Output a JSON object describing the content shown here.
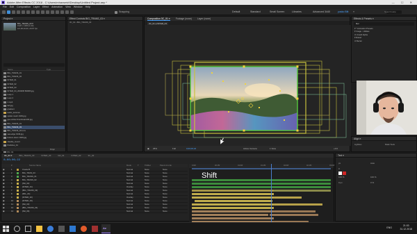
{
  "window": {
    "title": "Adobe After Effects CC 2018 - C:\\Users\\mhaxsmid\\Desktop\\Untitled Project.aep *",
    "controls": [
      "—",
      "☐",
      "✕"
    ]
  },
  "menu": [
    "File",
    "Edit",
    "Composition",
    "Layer",
    "Effect",
    "Animation",
    "View",
    "Window",
    "Help"
  ],
  "toolbar": {
    "snapping_label": "Snapping",
    "workspaces": [
      "Default",
      "Standard",
      "Small Screen",
      "Libraries",
      "Advanced 3440",
      "yusko Blit",
      "»"
    ],
    "active_workspace": "yusko Blit",
    "search_placeholder": "Search Help"
  },
  "project": {
    "title": "Project ≡",
    "selected_name": "BIG_TRANS_03 ▾",
    "info_lines": [
      "1920 x 1080 (1.00)",
      "Δ 0;00;10;00, 29.97 fps"
    ],
    "columns": [
      "Name",
      "Type"
    ],
    "items": [
      {
        "name": "BIG_TRANS_01",
        "folder": false,
        "selected": false
      },
      {
        "name": "BIG_TRANS_02",
        "folder": false,
        "selected": false
      },
      {
        "name": "INTER_01",
        "folder": false,
        "selected": false
      },
      {
        "name": "INTER_02",
        "folder": false,
        "selected": false
      },
      {
        "name": "INTER_03",
        "folder": false,
        "selected": false
      },
      {
        "name": "INTER_04_2000KB 800KB.jpg",
        "folder": false,
        "selected": false
      },
      {
        "name": "Loop 1",
        "folder": false,
        "selected": false
      },
      {
        "name": "Loop 2",
        "folder": false,
        "selected": false
      },
      {
        "name": "1.mp4",
        "folder": false,
        "selected": false
      },
      {
        "name": "bkf.jpg",
        "folder": false,
        "selected": false
      },
      {
        "name": "gradient",
        "folder": false,
        "selected": false
      },
      {
        "name": "audio_textures",
        "folder": true,
        "selected": false
      },
      {
        "name": "  spider-mesh 1949.jpg",
        "folder": false,
        "selected": false
      },
      {
        "name": "  gee-winter-thumbnail-200.jpg",
        "folder": false,
        "selected": false
      },
      {
        "name": "  BIG_TRANS_01",
        "folder": false,
        "selected": false
      },
      {
        "name": "  BIG_TRANS_03",
        "folder": false,
        "selected": true
      },
      {
        "name": "  BIG_TRANS_04.mov",
        "folder": false,
        "selected": false
      },
      {
        "name": "  sea-edge 1949.jpg",
        "folder": false,
        "selected": false
      },
      {
        "name": "  bottom-down 1949.jpg",
        "folder": false,
        "selected": false
      },
      {
        "name": "claudia_mount",
        "folder": true,
        "selected": false
      },
      {
        "name": "Particles_01",
        "folder": false,
        "selected": false
      },
      {
        "name": "Particles_02 copy",
        "folder": false,
        "selected": false
      },
      {
        "name": "Pin_01",
        "folder": false,
        "selected": false
      },
      {
        "name": "F_01",
        "folder": false,
        "selected": false
      },
      {
        "name": "solids",
        "folder": true,
        "selected": false
      },
      {
        "name": "black",
        "folder": false,
        "selected": false
      }
    ],
    "footer": "8 bpc"
  },
  "effect_controls": {
    "title": "Effect Controls BIG_TRANS_03 ≡",
    "breadcrumb": "3C_01 • BIG_TRANS_03"
  },
  "viewer": {
    "tabs": [
      "Composition 3C_01 ≡",
      "Footage (none)",
      "Layer (none)"
    ],
    "active_tab": "Composition 3C_01 ≡",
    "breadcrumb": "3C_01 ◂ INTER_03",
    "zoom": "25%",
    "resolution": "Full",
    "camera": "Active Camera",
    "views": "1 View",
    "timecode": "0;00;06;22",
    "exposure": "+0.0"
  },
  "effects_presets": {
    "title": "Effects & Presets ≡",
    "search_value": "blur",
    "lines": [
      "▾ * Animation Presets",
      "   ▾ Image - Utilities",
      "        ⦾ Unsoft Alpha",
      "▾ Distort",
      "        ⦾ Bezier"
    ]
  },
  "align": {
    "title": "Align ≡",
    "lights_label": "Lightbox",
    "layers_label": "Mask Tools"
  },
  "timeline": {
    "tabs": [
      "3C_01 ≡",
      "BIG_TRANS_03",
      "INTER_03",
      "bkf_01",
      "INTER_02",
      "3C_02"
    ],
    "active_tab": "3C_01 ≡",
    "current_time": "0;00;06;22",
    "header": [
      "#",
      "Source Name",
      "Mode",
      "T",
      "TrkMat",
      "Parent & Link"
    ],
    "layers": [
      {
        "num": "1",
        "name": "Create B",
        "mode": "Normal",
        "trkmat": "None",
        "parent": "None",
        "color": "#c0a040"
      },
      {
        "num": "2",
        "name": "BIG_TRAN_03",
        "mode": "Normal",
        "trkmat": "None",
        "parent": "None",
        "color": "#4fa84f"
      },
      {
        "num": "3",
        "name": "BIG_TRANS_01",
        "mode": "Normal",
        "trkmat": "None",
        "parent": "None",
        "color": "#4fa84f"
      },
      {
        "num": "4",
        "name": "BIG_TRANS_02",
        "mode": "Normal",
        "trkmat": "None",
        "parent": "None",
        "color": "#c9b04c"
      },
      {
        "num": "5",
        "name": "[Pal_02]",
        "mode": "Normal",
        "trkmat": "None",
        "parent": "None",
        "color": "#c9b04c"
      },
      {
        "num": "6",
        "name": "[INTER_01]",
        "mode": "Overlay",
        "trkmat": "None",
        "parent": "None",
        "color": "#c9b04c"
      },
      {
        "num": "7",
        "name": "[BIG_TRANS_03]",
        "mode": "Normal",
        "trkmat": "None",
        "parent": "None",
        "color": "#c9b04c"
      },
      {
        "num": "8",
        "name": "[PAL_01]",
        "mode": "Normal",
        "trkmat": "None",
        "parent": "None",
        "color": "#c9b04c"
      },
      {
        "num": "9",
        "name": "[INTER_02]",
        "mode": "Overlay",
        "trkmat": "None",
        "parent": "None",
        "color": "#c9b04c"
      },
      {
        "num": "10",
        "name": "[INTER_03]",
        "mode": "Normal",
        "trkmat": "None",
        "parent": "None",
        "color": "#b38b59"
      },
      {
        "num": "11",
        "name": "[Pal_03]",
        "mode": "Normal",
        "trkmat": "None",
        "parent": "None",
        "color": "#b38b59"
      },
      {
        "num": "12",
        "name": "[BIG_TRANS_04]",
        "mode": "Normal",
        "trkmat": "None",
        "parent": "None",
        "color": "#b38b59"
      },
      {
        "num": "13",
        "name": "[Pal_06]",
        "mode": "Normal",
        "trkmat": "None",
        "parent": "None",
        "color": "#b38b59"
      }
    ],
    "ruler_labels": [
      "0:00f",
      "00:15f",
      "01:00f",
      "01:15f",
      "02:00f",
      "02:15f",
      "03:00f"
    ],
    "overlay_caption": "Shift"
  },
  "text_panel": {
    "title": "Text ≡",
    "labels": [
      "px",
      "Auto",
      "0",
      "100 %",
      "100 %",
      "0 px",
      "0 %"
    ]
  },
  "taskbar": {
    "lang": "ENG",
    "time": "21:03",
    "date": "31.12.2018"
  }
}
